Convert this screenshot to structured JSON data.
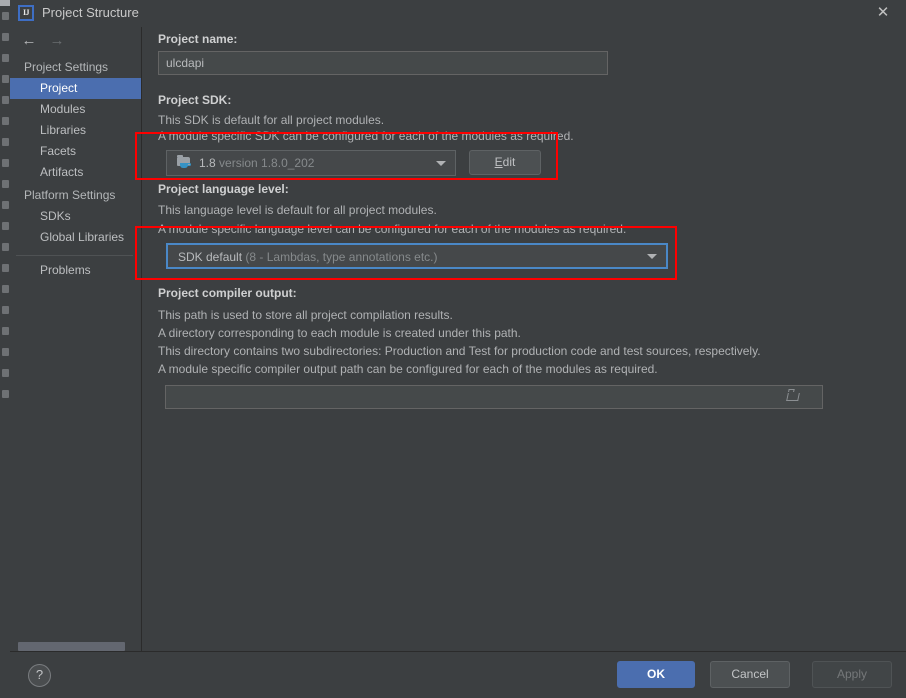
{
  "window": {
    "title": "Project Structure",
    "logo_text": "IJ",
    "close_label": "✕"
  },
  "nav": {
    "back": "←",
    "forward": "→"
  },
  "sidebar": {
    "groups": [
      {
        "label": "Project Settings",
        "items": [
          {
            "label": "Project",
            "selected": true
          },
          {
            "label": "Modules",
            "selected": false
          },
          {
            "label": "Libraries",
            "selected": false
          },
          {
            "label": "Facets",
            "selected": false
          },
          {
            "label": "Artifacts",
            "selected": false
          }
        ]
      },
      {
        "label": "Platform Settings",
        "items": [
          {
            "label": "SDKs",
            "selected": false
          },
          {
            "label": "Global Libraries",
            "selected": false
          }
        ]
      }
    ],
    "problems_label": "Problems"
  },
  "main": {
    "project_name": {
      "title": "Project name:",
      "value": "ulcdapi"
    },
    "project_sdk": {
      "title": "Project SDK:",
      "desc_line1": "This SDK is default for all project modules.",
      "desc_line2": "A module specific SDK can be configured for each of the modules as required.",
      "selected_name": "1.8",
      "selected_detail": "version 1.8.0_202",
      "edit_button_mnemonic": "E",
      "edit_button_rest": "dit"
    },
    "language_level": {
      "title": "Project language level:",
      "desc_line1": "This language level is default for all project modules.",
      "desc_line2": "A module specific language level can be configured for each of the modules as required.",
      "selected_name": "SDK default",
      "selected_detail": "(8 - Lambdas, type annotations etc.)"
    },
    "compiler_output": {
      "title": "Project compiler output:",
      "desc_line1": "This path is used to store all project compilation results.",
      "desc_line2": "A directory corresponding to each module is created under this path.",
      "desc_line3": "This directory contains two subdirectories: Production and Test for production code and test sources, respectively.",
      "desc_line4": "A module specific compiler output path can be configured for each of the modules as required.",
      "value": "",
      "placeholder": ""
    }
  },
  "footer": {
    "help_label": "?",
    "ok_label": "OK",
    "cancel_label": "Cancel",
    "apply_label": "Apply"
  },
  "annotations": {
    "highlight_color": "#fe0000",
    "boxes": [
      {
        "name": "sdk-highlight"
      },
      {
        "name": "language-level-highlight"
      }
    ]
  }
}
